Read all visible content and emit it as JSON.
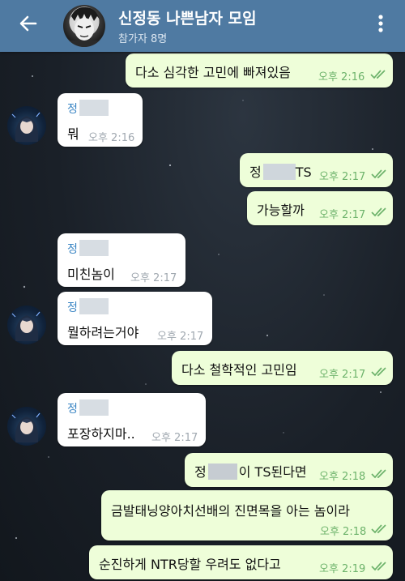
{
  "header": {
    "title": "신정동 나쁜남자 모임",
    "subtitle": "참가자 8명"
  },
  "messages": [
    {
      "dir": "out",
      "text": "다소 심각한 고민에 빠져있음",
      "time": "오후 2:16"
    },
    {
      "dir": "in",
      "sender": "정",
      "text": "뭐",
      "time": "오후 2:16"
    },
    {
      "dir": "out",
      "text_before": "정",
      "text_after": "TS",
      "time": "오후 2:17"
    },
    {
      "dir": "out",
      "text": "가능할까",
      "time": "오후 2:17"
    },
    {
      "dir": "in",
      "sender": "정",
      "text": "미친놈이",
      "time": "오후 2:17"
    },
    {
      "dir": "in",
      "sender": "정",
      "text": "뭘하려는거야",
      "time": "오후 2:17"
    },
    {
      "dir": "out",
      "text": "다소 철학적인 고민임",
      "time": "오후 2:17"
    },
    {
      "dir": "in",
      "sender": "정",
      "text": "포장하지마..",
      "time": "오후 2:17"
    },
    {
      "dir": "out",
      "text_before": "정",
      "text_after": "이 TS된다면",
      "time": "오후 2:18"
    },
    {
      "dir": "out",
      "text": "금발태닝양아치선배의 진면목을 아는 놈이라",
      "time": "오후 2:18"
    },
    {
      "dir": "out",
      "text": "순진하게 NTR당할 우려도 없다고",
      "time": "오후 2:19"
    }
  ]
}
